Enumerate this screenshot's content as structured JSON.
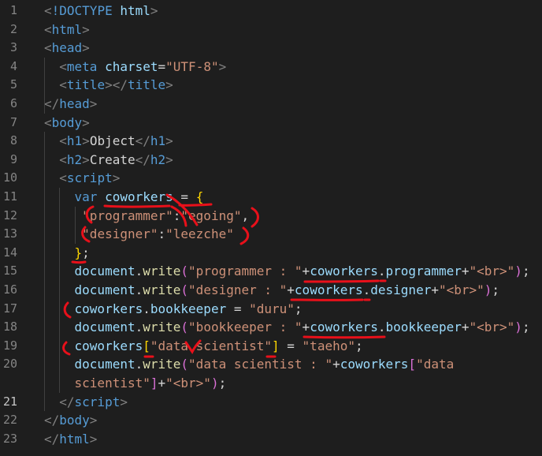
{
  "editor": {
    "active_line": 21,
    "lines": [
      {
        "n": "1",
        "tokens": [
          [
            "punc",
            "<"
          ],
          [
            "tag",
            "!DOCTYPE"
          ],
          [
            "txt",
            " "
          ],
          [
            "attr",
            "html"
          ],
          [
            "punc",
            ">"
          ]
        ]
      },
      {
        "n": "2",
        "tokens": [
          [
            "punc",
            "<"
          ],
          [
            "tag",
            "html"
          ],
          [
            "punc",
            ">"
          ]
        ]
      },
      {
        "n": "3",
        "tokens": [
          [
            "punc",
            "<"
          ],
          [
            "tag",
            "head"
          ],
          [
            "punc",
            ">"
          ]
        ]
      },
      {
        "n": "4",
        "tokens": [
          [
            "txt",
            "  "
          ],
          [
            "punc",
            "<"
          ],
          [
            "tag",
            "meta"
          ],
          [
            "txt",
            " "
          ],
          [
            "attr",
            "charset"
          ],
          [
            "txt",
            "="
          ],
          [
            "str",
            "\"UTF-8\""
          ],
          [
            "punc",
            ">"
          ]
        ]
      },
      {
        "n": "5",
        "tokens": [
          [
            "txt",
            "  "
          ],
          [
            "punc",
            "<"
          ],
          [
            "tag",
            "title"
          ],
          [
            "punc",
            "></"
          ],
          [
            "tag",
            "title"
          ],
          [
            "punc",
            ">"
          ]
        ]
      },
      {
        "n": "6",
        "tokens": [
          [
            "punc",
            "</"
          ],
          [
            "tag",
            "head"
          ],
          [
            "punc",
            ">"
          ]
        ]
      },
      {
        "n": "7",
        "tokens": [
          [
            "punc",
            "<"
          ],
          [
            "tag",
            "body"
          ],
          [
            "punc",
            ">"
          ]
        ]
      },
      {
        "n": "8",
        "tokens": [
          [
            "txt",
            "  "
          ],
          [
            "punc",
            "<"
          ],
          [
            "tag",
            "h1"
          ],
          [
            "punc",
            ">"
          ],
          [
            "txt",
            "Object"
          ],
          [
            "punc",
            "</"
          ],
          [
            "tag",
            "h1"
          ],
          [
            "punc",
            ">"
          ]
        ]
      },
      {
        "n": "9",
        "tokens": [
          [
            "txt",
            "  "
          ],
          [
            "punc",
            "<"
          ],
          [
            "tag",
            "h2"
          ],
          [
            "punc",
            ">"
          ],
          [
            "txt",
            "Create"
          ],
          [
            "punc",
            "</"
          ],
          [
            "tag",
            "h2"
          ],
          [
            "punc",
            ">"
          ]
        ]
      },
      {
        "n": "10",
        "tokens": [
          [
            "txt",
            "  "
          ],
          [
            "punc",
            "<"
          ],
          [
            "tag",
            "script"
          ],
          [
            "punc",
            ">"
          ]
        ]
      },
      {
        "n": "11",
        "tokens": [
          [
            "txt",
            "    "
          ],
          [
            "kw",
            "var"
          ],
          [
            "txt",
            " "
          ],
          [
            "var",
            "coworkers"
          ],
          [
            "txt",
            " = "
          ],
          [
            "brace",
            "{"
          ]
        ]
      },
      {
        "n": "12",
        "tokens": [
          [
            "txt",
            "     "
          ],
          [
            "str",
            "\"programmer\""
          ],
          [
            "txt",
            ":"
          ],
          [
            "str",
            "\"egoing\""
          ],
          [
            "txt",
            ","
          ]
        ]
      },
      {
        "n": "13",
        "tokens": [
          [
            "txt",
            "     "
          ],
          [
            "str",
            "\"designer\""
          ],
          [
            "txt",
            ":"
          ],
          [
            "str",
            "\"leezche\""
          ]
        ]
      },
      {
        "n": "14",
        "tokens": [
          [
            "txt",
            "    "
          ],
          [
            "brace",
            "}"
          ],
          [
            "txt",
            ";"
          ]
        ]
      },
      {
        "n": "15",
        "tokens": [
          [
            "txt",
            "    "
          ],
          [
            "var",
            "document"
          ],
          [
            "txt",
            "."
          ],
          [
            "fn",
            "write"
          ],
          [
            "brk",
            "("
          ],
          [
            "str",
            "\"programmer : \""
          ],
          [
            "txt",
            "+"
          ],
          [
            "var",
            "coworkers"
          ],
          [
            "txt",
            "."
          ],
          [
            "var",
            "programmer"
          ],
          [
            "txt",
            "+"
          ],
          [
            "str",
            "\"<br>\""
          ],
          [
            "brk",
            ")"
          ],
          [
            "txt",
            ";"
          ]
        ]
      },
      {
        "n": "16",
        "tokens": [
          [
            "txt",
            "    "
          ],
          [
            "var",
            "document"
          ],
          [
            "txt",
            "."
          ],
          [
            "fn",
            "write"
          ],
          [
            "brk",
            "("
          ],
          [
            "str",
            "\"designer : \""
          ],
          [
            "txt",
            "+"
          ],
          [
            "var",
            "coworkers"
          ],
          [
            "txt",
            "."
          ],
          [
            "var",
            "designer"
          ],
          [
            "txt",
            "+"
          ],
          [
            "str",
            "\"<br>\""
          ],
          [
            "brk",
            ")"
          ],
          [
            "txt",
            ";"
          ]
        ]
      },
      {
        "n": "17",
        "tokens": [
          [
            "txt",
            "    "
          ],
          [
            "var",
            "coworkers"
          ],
          [
            "txt",
            "."
          ],
          [
            "var",
            "bookkeeper"
          ],
          [
            "txt",
            " = "
          ],
          [
            "str",
            "\"duru\""
          ],
          [
            "txt",
            ";"
          ]
        ]
      },
      {
        "n": "18",
        "tokens": [
          [
            "txt",
            "    "
          ],
          [
            "var",
            "document"
          ],
          [
            "txt",
            "."
          ],
          [
            "fn",
            "write"
          ],
          [
            "brk",
            "("
          ],
          [
            "str",
            "\"bookkeeper : \""
          ],
          [
            "txt",
            "+"
          ],
          [
            "var",
            "coworkers"
          ],
          [
            "txt",
            "."
          ],
          [
            "var",
            "bookkeeper"
          ],
          [
            "txt",
            "+"
          ],
          [
            "str",
            "\"<br>\""
          ],
          [
            "brk",
            ")"
          ],
          [
            "txt",
            ";"
          ]
        ]
      },
      {
        "n": "19",
        "tokens": [
          [
            "txt",
            "    "
          ],
          [
            "var",
            "coworkers"
          ],
          [
            "brace",
            "["
          ],
          [
            "str",
            "\"data scientist\""
          ],
          [
            "brace",
            "]"
          ],
          [
            "txt",
            " = "
          ],
          [
            "str",
            "\"taeho\""
          ],
          [
            "txt",
            ";"
          ]
        ]
      },
      {
        "n": "20",
        "tokens": [
          [
            "txt",
            "    "
          ],
          [
            "var",
            "document"
          ],
          [
            "txt",
            "."
          ],
          [
            "fn",
            "write"
          ],
          [
            "brk",
            "("
          ],
          [
            "str",
            "\"data scientist : \""
          ],
          [
            "txt",
            "+"
          ],
          [
            "var",
            "coworkers"
          ],
          [
            "brk",
            "["
          ],
          [
            "str",
            "\"data"
          ]
        ]
      },
      {
        "n": "",
        "tokens": [
          [
            "txt",
            "    "
          ],
          [
            "str",
            "scientist\""
          ],
          [
            "brk",
            "]"
          ],
          [
            "txt",
            "+"
          ],
          [
            "str",
            "\"<br>\""
          ],
          [
            "brk",
            ")"
          ],
          [
            "txt",
            ";"
          ]
        ]
      },
      {
        "n": "21",
        "tokens": [
          [
            "txt",
            "  "
          ],
          [
            "punc",
            "</"
          ],
          [
            "tag",
            "script"
          ],
          [
            "punc",
            ">"
          ]
        ]
      },
      {
        "n": "22",
        "tokens": [
          [
            "punc",
            "</"
          ],
          [
            "tag",
            "body"
          ],
          [
            "punc",
            ">"
          ]
        ]
      },
      {
        "n": "23",
        "tokens": [
          [
            "punc",
            "</"
          ],
          [
            "tag",
            "html"
          ],
          [
            "punc",
            ">"
          ]
        ]
      }
    ]
  }
}
